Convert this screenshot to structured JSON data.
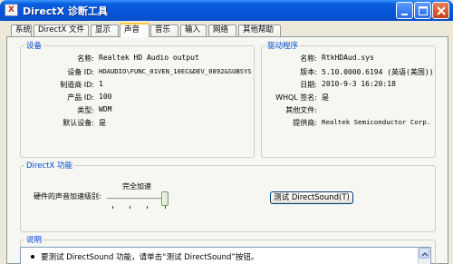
{
  "window": {
    "title": "DirectX 诊断工具",
    "title_icon_glyph": "X",
    "buttons": [
      "minimize",
      "maximize",
      "close"
    ]
  },
  "tabs": [
    {
      "label": "系统",
      "active": false
    },
    {
      "label": "DirectX 文件",
      "active": false
    },
    {
      "label": "显示",
      "active": false
    },
    {
      "label": "声音",
      "active": true
    },
    {
      "label": "音乐",
      "active": false
    },
    {
      "label": "输入",
      "active": false
    },
    {
      "label": "网络",
      "active": false
    },
    {
      "label": "其他帮助",
      "active": false
    }
  ],
  "device": {
    "legend": "设备",
    "rows": [
      {
        "label": "名称:",
        "value": "Realtek HD Audio output"
      },
      {
        "label": "设备 ID:",
        "value": "HDAUDIO\\FUNC_01VEN_10EC&DEV_0892&SUBSYS_145"
      },
      {
        "label": "制造商 ID:",
        "value": "1"
      },
      {
        "label": "产品 ID:",
        "value": "100"
      },
      {
        "label": "类型:",
        "value": "WDM"
      },
      {
        "label": "默认设备:",
        "value": "是"
      }
    ]
  },
  "driver": {
    "legend": "驱动程序",
    "rows": [
      {
        "label": "名称:",
        "value": "RtkHDAud.sys"
      },
      {
        "label": "版本:",
        "value": "5.10.0000.6194 (英语(美国))"
      },
      {
        "label": "日期:",
        "value": "2010-9-3 16:20:18"
      },
      {
        "label": "WHQL 签名:",
        "value": "是"
      },
      {
        "label": "其他文件:",
        "value": ""
      },
      {
        "label": "提供商:",
        "value": "Realtek Semiconductor Corp."
      }
    ]
  },
  "directx": {
    "legend": "DirectX 功能",
    "accel_label": "硬件的声音加速级别:",
    "accel_value": "完全加速",
    "accel_level": 1.0,
    "test_button": "测试 DirectSound(T)"
  },
  "notes": {
    "legend": "说明",
    "text": "要测试 DirectSound 功能，请单击“测试 DirectSound”按钮。"
  },
  "colors": {
    "titlebar": "#0654d6",
    "group_legend": "#0046d5",
    "tab_highlight": "#ffc83c",
    "close_button": "#c3411a"
  }
}
